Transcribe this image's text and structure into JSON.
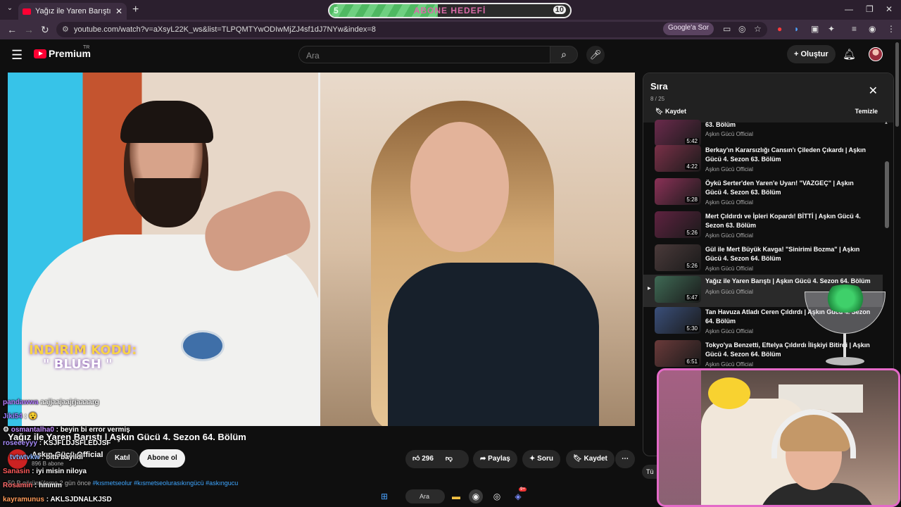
{
  "browser": {
    "tab_title": "Yağız ile Yaren Barıştı | Aşkın Gü",
    "url": "youtube.com/watch?v=aXsyL22K_ws&list=TLPQMTYwODIwMjZJ4sf1dJ7NYw&index=8",
    "google_ask": "Google'a Sor",
    "new_tab": "+",
    "close_tab": "✕"
  },
  "sub_goal": {
    "start": "5",
    "label": "ABONE HEDEFİ",
    "end": "10",
    "progress_fraction": 0.45
  },
  "youtube": {
    "logo_text": "Premium",
    "logo_region": "TR",
    "search_placeholder": "Ara",
    "create_label": "Oluştur"
  },
  "video": {
    "overlay_line1": "İNDİRİM KODU:",
    "overlay_line2": "\" BLUSH \"",
    "title": "Yağız ile Yaren Barıştı | Aşkın Gücü 4. Sezon 64. Bölüm",
    "channel": "Aşkın Gücü Official",
    "subscribers": "896 B abone",
    "join_label": "Katıl",
    "subscribe_label": "Abone ol",
    "likes": "296",
    "share_label": "Paylaş",
    "ask_label": "Soru",
    "save_label": "Kaydet",
    "meta_views": "50 B görüntüleme  2 gün önce",
    "meta_tags": "#kısmetseolur #kısmetseolurasıkıngücü #askıngucu"
  },
  "chat": [
    {
      "user": "pandawwa",
      "text": "aajjaajaajrjaaaarg",
      "color": "#b57cff"
    },
    {
      "user": "Jiki54",
      "text": ":",
      "color": "#9c7bff"
    },
    {
      "user": "osmantalha0",
      "text": ": beyin bi error vermiş",
      "color": "#c38cff"
    },
    {
      "user": "roseeeyyy",
      "text": ": KSJFLDJSFLEDJSF",
      "color": "#a78bfa"
    },
    {
      "user": "tvtwtvkw",
      "text": ": bitti bayıldı",
      "color": "#8ab4ff"
    },
    {
      "user": "Sanasin",
      "text": ": iyi misin niloya",
      "color": "#ff5a5a"
    },
    {
      "user": "Rosamin",
      "text": ": hmmm",
      "color": "#ff6b6b"
    },
    {
      "user": "kayramunus",
      "text": ": AKLSJDNALKJSD",
      "color": "#ff9b5a"
    }
  ],
  "queue": {
    "title": "Sıra",
    "count": "8 / 25",
    "save_label": "Kaydet",
    "clear_label": "Temizle",
    "items": [
      {
        "title": "63. Bölüm",
        "channel": "Aşkın Gücü Official",
        "duration": "5:42",
        "thumb": "#6b2a4c"
      },
      {
        "title": "Berkay'ın Kararsızlığı Cansın'ı Çileden Çıkardı | Aşkın Gücü 4. Sezon 63. Bölüm",
        "channel": "Aşkın Gücü Official",
        "duration": "4:22",
        "thumb": "#7a3048"
      },
      {
        "title": "Öykü Serter'den Yaren'e Uyarı! \"VAZGEÇ\" | Aşkın Gücü 4. Sezon 63. Bölüm",
        "channel": "Aşkın Gücü Official",
        "duration": "5:28",
        "thumb": "#8b3157"
      },
      {
        "title": "Mert Çıldırdı ve İpleri Kopardı! BİTTİ | Aşkın Gücü 4. Sezon 63. Bölüm",
        "channel": "Aşkın Gücü Official",
        "duration": "5:26",
        "thumb": "#5f2240"
      },
      {
        "title": "Gül ile Mert Büyük Kavga! \"Sinirimi Bozma\" | Aşkın Gücü 4. Sezon 64. Bölüm",
        "channel": "Aşkın Gücü Official",
        "duration": "5:26",
        "thumb": "#4a3a3a"
      },
      {
        "title": "Yağız ile Yaren Barıştı | Aşkın Gücü 4. Sezon 64. Bölüm",
        "channel": "Aşkın Gücü Official",
        "duration": "5:47",
        "thumb": "#3f6a55"
      },
      {
        "title": "Tan Havuza Atladı Ceren Çıldırdı | Aşkın Gücü 4. Sezon 64. Bölüm",
        "channel": "Aşkın Gücü Official",
        "duration": "5:30",
        "thumb": "#3a4f7a"
      },
      {
        "title": "Tokyo'ya Benzetti, Eftelya Çıldırdı İlişkiyi Bitirdi | Aşkın Gücü 4. Sezon 64. Bölüm",
        "channel": "Aşkın Gücü Official",
        "duration": "6:51",
        "thumb": "#6a3a3a"
      }
    ]
  },
  "taskbar": {
    "search_label": "Ara",
    "discord_badge": "9+"
  },
  "partial_button": "Tü",
  "colors": {
    "accent_red": "#ff0033",
    "cam_border": "#e46ac8",
    "tag_blue": "#3ea6ff"
  }
}
